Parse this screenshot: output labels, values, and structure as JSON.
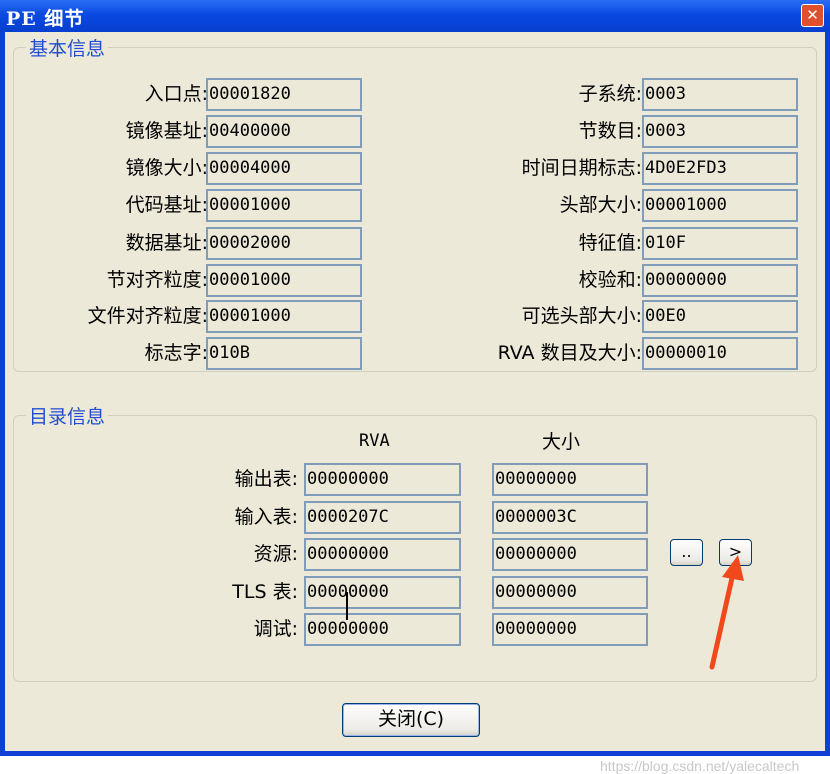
{
  "window": {
    "title": "PE 细节",
    "close_glyph": "✕"
  },
  "basic": {
    "legend": "基本信息",
    "left": [
      {
        "label": "入口点:",
        "value": "00001820"
      },
      {
        "label": "镜像基址:",
        "value": "00400000"
      },
      {
        "label": "镜像大小:",
        "value": "00004000"
      },
      {
        "label": "代码基址:",
        "value": "00001000"
      },
      {
        "label": "数据基址:",
        "value": "00002000"
      },
      {
        "label": "节对齐粒度:",
        "value": "00001000"
      },
      {
        "label": "文件对齐粒度:",
        "value": "00001000"
      },
      {
        "label": "标志字:",
        "value": "010B"
      }
    ],
    "right": [
      {
        "label": "子系统:",
        "value": "0003"
      },
      {
        "label": "节数目:",
        "value": "0003"
      },
      {
        "label": "时间日期标志:",
        "value": "4D0E2FD3"
      },
      {
        "label": "头部大小:",
        "value": "00001000"
      },
      {
        "label": "特征值:",
        "value": "010F"
      },
      {
        "label": "校验和:",
        "value": "00000000"
      },
      {
        "label": "可选头部大小:",
        "value": "00E0"
      },
      {
        "label": "RVA 数目及大小:",
        "value": "00000010"
      }
    ]
  },
  "directory": {
    "legend": "目录信息",
    "col_rva": "RVA",
    "col_size": "大小",
    "rows": [
      {
        "label": "输出表:",
        "rva": "00000000",
        "size": "00000000"
      },
      {
        "label": "输入表:",
        "rva": "0000207C",
        "size": "0000003C"
      },
      {
        "label": "资源:",
        "rva": "00000000",
        "size": "00000000"
      },
      {
        "label": "TLS 表:",
        "rva": "00000000",
        "size": "00000000"
      },
      {
        "label": "调试:",
        "rva": "00000000",
        "size": "00000000"
      }
    ],
    "btn_more": "..",
    "btn_next": ">"
  },
  "footer": {
    "close_label": "关闭(C)"
  },
  "watermark": "https://blog.csdn.net/yalecaltech",
  "colors": {
    "title_bar": "#0a49e0",
    "dialog_bg": "#ece9d8",
    "legend_text": "#1f4fd0",
    "field_border": "#7f9db9",
    "arrow": "#f04a1c"
  },
  "icons": {
    "close": "close-icon",
    "annotation": "red-arrow-icon"
  }
}
